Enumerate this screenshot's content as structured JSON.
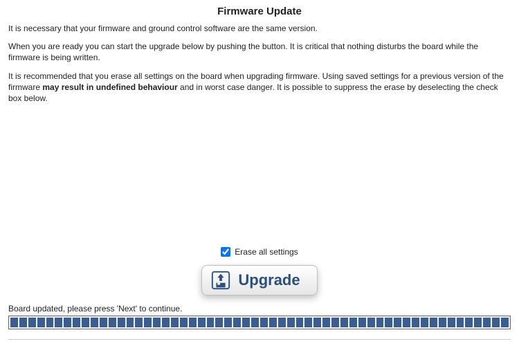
{
  "title": "Firmware Update",
  "intro": {
    "p1": "It is necessary that your firmware and ground control software are the same version.",
    "p2": "When you are ready you can start the upgrade below by pushing the button. It is critical that nothing disturbs the board while the firmware is being written.",
    "p3a": "It is recommended that you erase all settings on the board when upgrading firmware. Using saved settings for a previous version of the firmware ",
    "p3bold": "may result in undefined behaviour",
    "p3b": " and in worst case danger. It is possible to suppress the erase by deselecting the check box below."
  },
  "checkbox": {
    "label": "Erase all settings",
    "checked": true
  },
  "upgrade_button_label": "Upgrade",
  "status_text": "Board updated, please press 'Next' to continue.",
  "progress": {
    "segments": 56,
    "filled": 56
  },
  "colors": {
    "accent_text": "#2b4f7e",
    "progress_fill": "#3b5e92"
  }
}
